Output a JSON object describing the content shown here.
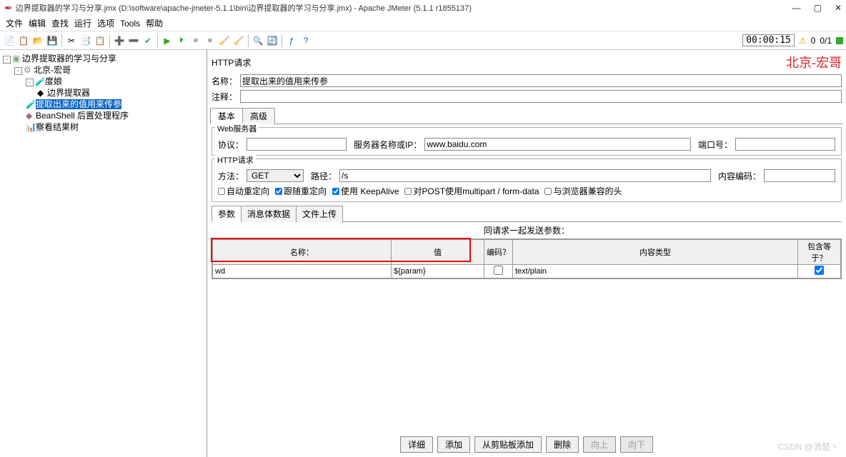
{
  "title_bar": {
    "text": "边界提取器的学习与分享.jmx (D:\\software\\apache-jmeter-5.1.1\\bin\\边界提取器的学习与分享.jmx) - Apache JMeter (5.1.1 r1855137)"
  },
  "menu": {
    "items": [
      "文件",
      "编辑",
      "查找",
      "运行",
      "选项",
      "Tools",
      "帮助"
    ]
  },
  "status": {
    "timer": "00:00:15",
    "warn_icon": "⚠",
    "warn_count": "0",
    "run_frac": "0/1"
  },
  "tree": {
    "n0": "边界提取器的学习与分享",
    "n1": "北京-宏哥",
    "n2": "度娘",
    "n3": "边界提取器",
    "n4": "提取出来的值用来传参",
    "n5": "BeanShell 后置处理程序",
    "n6": "察看结果树"
  },
  "panel": {
    "title": "HTTP请求",
    "watermark": "北京-宏哥",
    "name_label": "名称：",
    "name_value": "提取出来的值用来传参",
    "comment_label": "注释：",
    "comment_value": "",
    "tab_basic": "基本",
    "tab_adv": "高级",
    "webserver_legend": "Web服务器",
    "protocol_label": "协议：",
    "protocol_value": "",
    "servername_label": "服务器名称或IP：",
    "servername_value": "www.baidu.com",
    "port_label": "端口号：",
    "port_value": "",
    "httpreq_legend": "HTTP请求",
    "method_label": "方法：",
    "method_value": "GET",
    "path_label": "路径：",
    "path_value": "/s",
    "encoding_label": "内容编码：",
    "encoding_value": "",
    "cb_autoredirect": "自动重定向",
    "cb_followredirect": "跟随重定向",
    "cb_keepalive": "使用 KeepAlive",
    "cb_multipart": "对POST使用multipart / form-data",
    "cb_browser": "与浏览器兼容的头",
    "ptab_params": "参数",
    "ptab_body": "消息体数据",
    "ptab_files": "文件上传",
    "params_label": "同请求一起发送参数：",
    "th_name": "名称：",
    "th_value": "值",
    "th_encode": "编码？",
    "th_ctype": "内容类型",
    "th_include": "包含等于？",
    "row": {
      "name": "wd",
      "value": "${param}",
      "encode": false,
      "ctype": "text/plain",
      "include": true
    },
    "btn_detail": "详细",
    "btn_add": "添加",
    "btn_clip": "从剪贴板添加",
    "btn_del": "删除",
    "btn_up": "向上",
    "btn_down": "向下"
  },
  "watermark_csdn": "CSDN @流楚丶"
}
